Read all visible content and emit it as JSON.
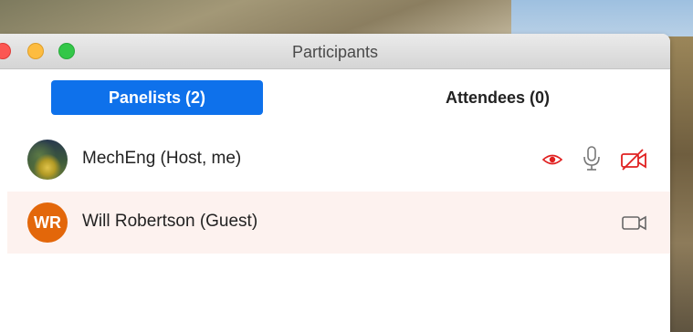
{
  "window": {
    "title": "Participants"
  },
  "tabs": [
    {
      "label": "Panelists (2)",
      "active": true
    },
    {
      "label": "Attendees (0)",
      "active": false
    }
  ],
  "participants": [
    {
      "name": "MechEng (Host, me)",
      "avatar": "photo",
      "icons": [
        "recording-icon",
        "microphone-icon",
        "video-off-icon"
      ]
    },
    {
      "name": "Will Robertson (Guest)",
      "initials": "WR",
      "avatar_color": "#e3670a",
      "icons": [
        "video-camera-icon"
      ]
    }
  ],
  "colors": {
    "accent": "#0e71eb",
    "alert": "#e02020",
    "row_highlight": "#fdf2ef"
  }
}
